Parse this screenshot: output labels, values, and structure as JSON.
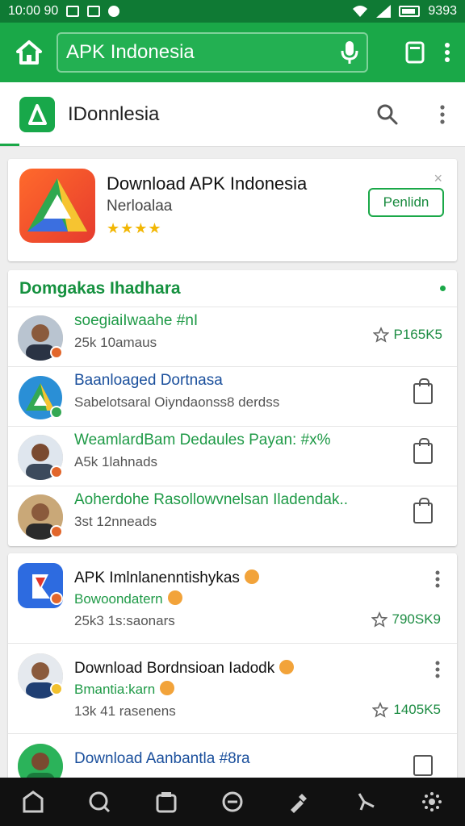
{
  "statusbar": {
    "time": "10:00 90",
    "battery": "9393"
  },
  "toolbar": {
    "url": "APK Indonesia"
  },
  "header": {
    "title": "IDonnlesia"
  },
  "featured": {
    "title": "Download APK Indonesia",
    "subtitle": "Nerloalaa",
    "rating_stars": "★★★★",
    "install_label": "Penlidn",
    "close_label": "×"
  },
  "section": {
    "title": "Domgakas Ihadhara",
    "rows": [
      {
        "title": "soegiaiIwaahe #nI",
        "subtitle": "25k 10amaus",
        "right_text": "P165K5"
      },
      {
        "title": "Baanloaged Dortnasa",
        "subtitle": "Sabelotsaral Oiyndaonss8 derdss",
        "right_text": ""
      },
      {
        "title": "WeamlardBam Dedaules Payan: #x%",
        "subtitle": "A5k 1lahnads",
        "right_text": ""
      },
      {
        "title": "Aoherdohe Rasollowvnelsan Iladendak..",
        "subtitle": "3st 12nneads",
        "right_text": ""
      }
    ]
  },
  "list": [
    {
      "title": "APK Imlnlanenntishykas",
      "subtitle": "Bowoondatern",
      "meta": "25k3 1s:saonars",
      "right_text": "790SK9"
    },
    {
      "title": "Download Bordnsioan Iadodk",
      "subtitle": "Bmantia:karn",
      "meta": "13k 41 rasenens",
      "right_text": "1405K5"
    },
    {
      "title": "Download Aanbantla #8ra",
      "subtitle": "",
      "meta": "",
      "right_text": ""
    }
  ],
  "colors": {
    "primary": "#1aa848",
    "dark": "#0f7a34",
    "accent_star": "#f2b705"
  }
}
